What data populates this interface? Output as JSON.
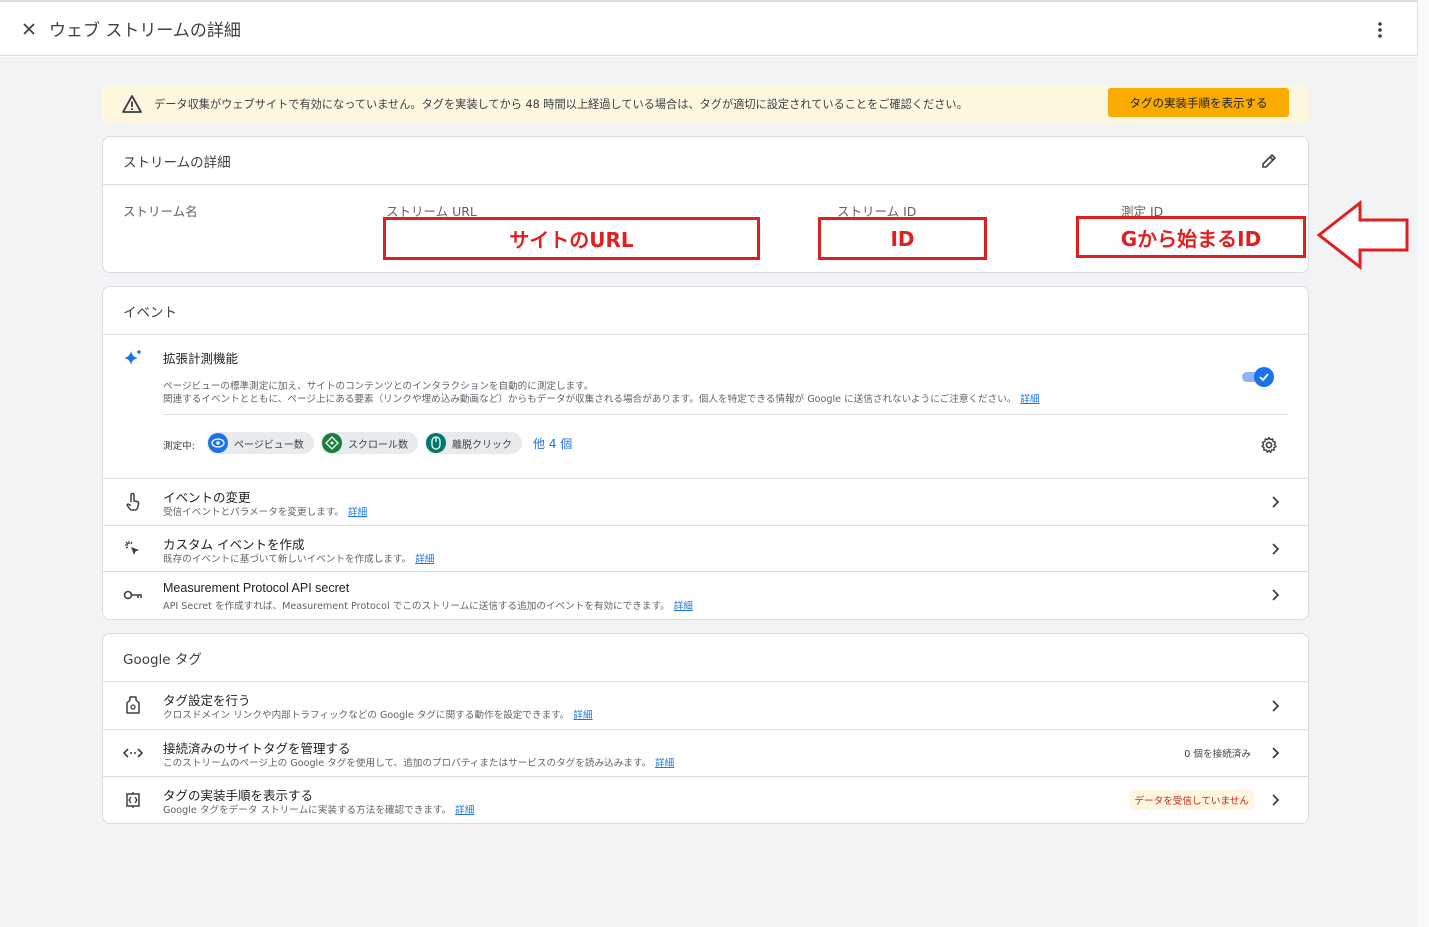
{
  "header": {
    "title": "ウェブ ストリームの詳細"
  },
  "alert": {
    "text": "データ収集がウェブサイトで有効になっていません。タグを実装してから 48 時間以上経過している場合は、タグが適切に設定されていることをご確認ください。",
    "button_label": "タグの実装手順を表示する"
  },
  "stream_details": {
    "title": "ストリームの詳細",
    "labels": {
      "name": "ストリーム名",
      "url": "ストリーム URL",
      "id": "ストリーム ID",
      "measurement_id": "測定 ID"
    },
    "annotations": {
      "url_box": "サイトのURL",
      "id_box": "ID",
      "measurement_box": "Gから始まるID"
    }
  },
  "events": {
    "title": "イベント",
    "enhanced": {
      "title": "拡張計測機能",
      "desc1": "ページビューの標準測定に加え、サイトのコンテンツとのインタラクションを自動的に測定します。",
      "desc2": "関連するイベントとともに、ページ上にある要素（リンクや埋め込み動画など）からもデータが収集される場合があります。個人を特定できる情報が Google に送信されないようにご注意ください。",
      "link": "詳細",
      "measuring_label": "測定中:",
      "chips": [
        "ページビュー数",
        "スクロール数",
        "離脱クリック"
      ],
      "more_label": "他 4 個",
      "enabled": true
    },
    "rows": [
      {
        "title": "イベントの変更",
        "desc": "受信イベントとパラメータを変更します。",
        "link": "詳細"
      },
      {
        "title": "カスタム イベントを作成",
        "desc": "既存のイベントに基づいて新しいイベントを作成します。",
        "link": "詳細"
      },
      {
        "title": "Measurement Protocol API secret",
        "desc": "API Secret を作成すれば、Measurement Protocol でこのストリームに送信する追加のイベントを有効にできます。",
        "link": "詳細"
      }
    ]
  },
  "google_tag": {
    "title": "Google タグ",
    "rows": [
      {
        "title": "タグ設定を行う",
        "desc": "クロスドメイン リンクや内部トラフィックなどの Google タグに関する動作を設定できます。",
        "link": "詳細"
      },
      {
        "title": "接続済みのサイトタグを管理する",
        "desc": "このストリームのページ上の Google タグを使用して、追加のプロパティまたはサービスのタグを読み込みます。",
        "link": "詳細",
        "status": "0 個を接続済み"
      },
      {
        "title": "タグの実装手順を表示する",
        "desc": "Google タグをデータ ストリームに実装する方法を確認できます。",
        "link": "詳細",
        "status": "データを受信していません"
      }
    ]
  },
  "colors": {
    "accent": "#1a73e8",
    "warning_bg": "#fef7e0",
    "warning_btn": "#f9ab00",
    "annotation_red": "#e02020"
  }
}
